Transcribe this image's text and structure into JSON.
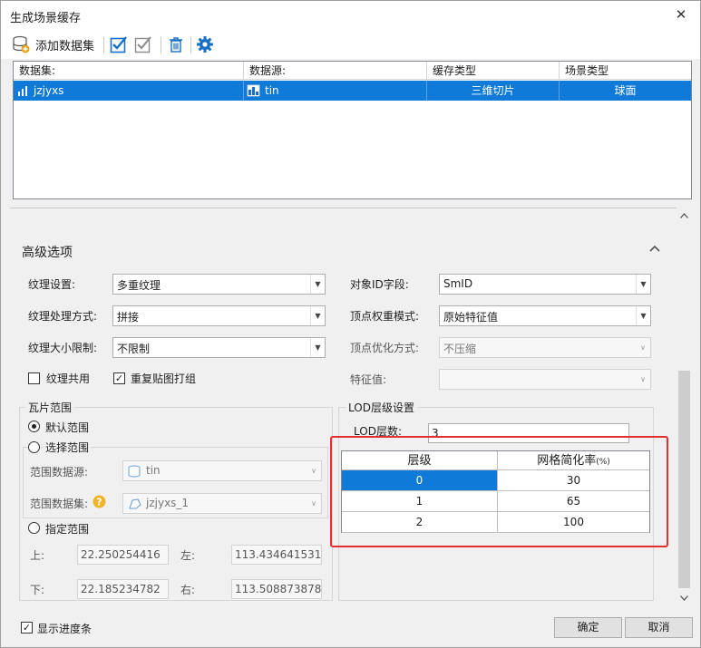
{
  "window": {
    "title": "生成场景缓存",
    "close_glyph": "✕"
  },
  "toolbar": {
    "add_dataset_label": "添加数据集"
  },
  "datasets": {
    "headers": [
      "数据集:",
      "数据源:",
      "缓存类型",
      "场景类型"
    ],
    "rows": [
      {
        "dataset": "jzjyxs",
        "datasource": "tin",
        "cache_type": "三维切片",
        "scene_type": "球面"
      }
    ]
  },
  "advanced": {
    "title": "高级选项",
    "texture_setting_label": "纹理设置:",
    "texture_setting_value": "多重纹理",
    "texture_process_label": "纹理处理方式:",
    "texture_process_value": "拼接",
    "texture_size_label": "纹理大小限制:",
    "texture_size_value": "不限制",
    "texture_share_label": "纹理共用",
    "repeat_tile_label": "重复贴图打组",
    "object_id_label": "对象ID字段:",
    "object_id_value": "SmID",
    "vertex_weight_label": "顶点权重模式:",
    "vertex_weight_value": "原始特征值",
    "vertex_opt_label": "顶点优化方式:",
    "vertex_opt_value": "不压缩",
    "feature_label": "特征值:",
    "feature_value": ""
  },
  "tile_range": {
    "title": "瓦片范围",
    "default_label": "默认范围",
    "select_label": "选择范围",
    "range_datasource_label": "范围数据源:",
    "range_datasource_value": "tin",
    "range_dataset_label": "范围数据集:",
    "range_dataset_value": "jzjyxs_1",
    "custom_label": "指定范围",
    "top_label": "上:",
    "top_value": "22.250254416",
    "left_label": "左:",
    "left_value": "113.434641531",
    "bottom_label": "下:",
    "bottom_value": "22.185234782",
    "right_label": "右:",
    "right_value": "113.508873878"
  },
  "lod": {
    "title": "LOD层级设置",
    "count_label": "LOD层数:",
    "count_value": "3",
    "col_level": "层级",
    "col_rate": "网格简化率",
    "col_rate_unit": "(%)",
    "rows": [
      {
        "level": "0",
        "rate": "30"
      },
      {
        "level": "1",
        "rate": "65"
      },
      {
        "level": "2",
        "rate": "100"
      }
    ]
  },
  "footer": {
    "show_progress_label": "显示进度条",
    "ok_label": "确定",
    "cancel_label": "取消"
  },
  "colors": {
    "selection": "#0f7ad8",
    "highlight_box": "#e03030",
    "icon_blue": "#1a6fc4"
  }
}
